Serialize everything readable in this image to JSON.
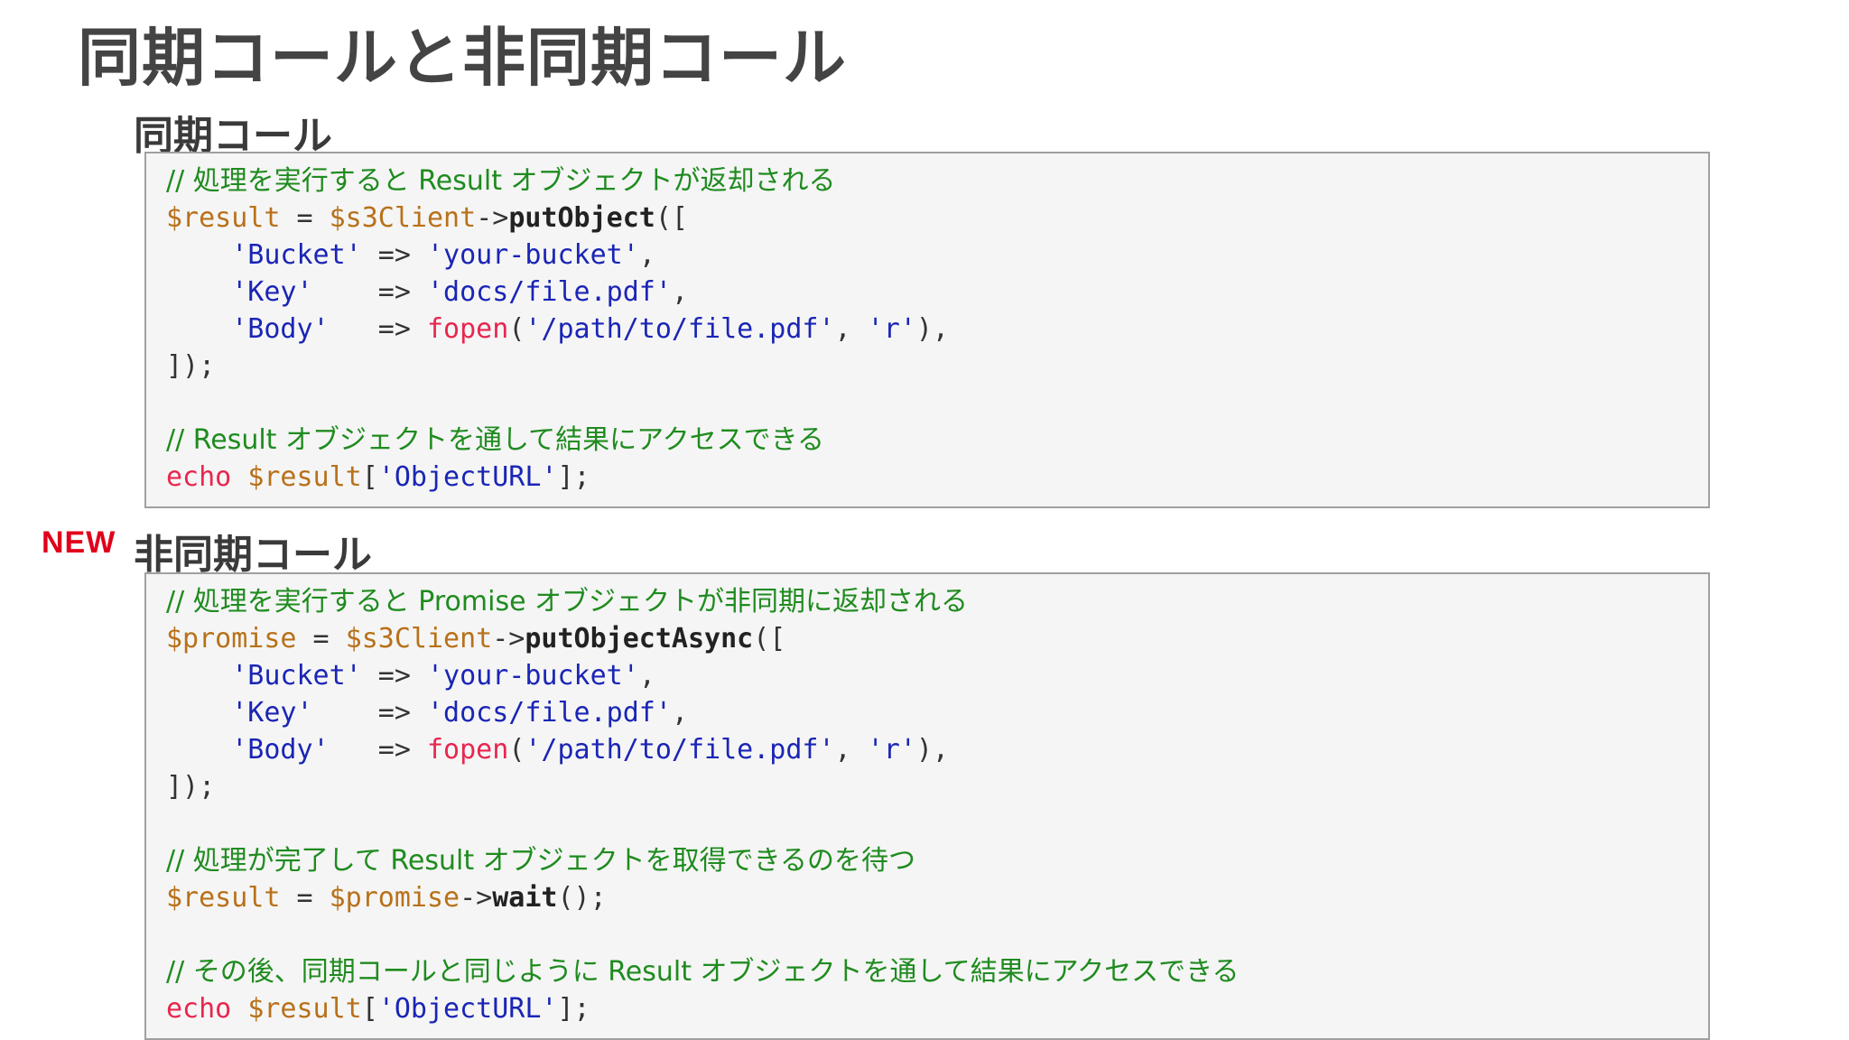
{
  "title": "同期コールと非同期コール",
  "sync": {
    "heading": "同期コール",
    "comment1": "// 処理を実行すると Result オブジェクトが返却される",
    "line1": {
      "var_result": "$result",
      "eq": " = ",
      "var_client": "$s3Client",
      "arrow": "->",
      "method": "putObject",
      "open": "(["
    },
    "bucket": {
      "indent": "    ",
      "key": "'Bucket'",
      "arrow": " => ",
      "value": "'your-bucket'",
      "tail": ","
    },
    "key": {
      "indent": "    ",
      "key": "'Key'",
      "arrow": "    => ",
      "value": "'docs/file.pdf'",
      "tail": ","
    },
    "body": {
      "indent": "    ",
      "key": "'Body'",
      "arrow": "   => ",
      "fn": "fopen",
      "open": "(",
      "arg1": "'/path/to/file.pdf'",
      "sep": ", ",
      "arg2": "'r'",
      "tail": "),"
    },
    "close": "]);",
    "comment2": "// Result オブジェクトを通して結果にアクセスできる",
    "echo": {
      "kw": "echo",
      "space": " ",
      "var": "$result",
      "open": "[",
      "key": "'ObjectURL'",
      "close": "];"
    }
  },
  "async": {
    "badge": "NEW",
    "heading": "非同期コール",
    "comment1": "// 処理を実行すると Promise オブジェクトが非同期に返却される",
    "line1": {
      "var_promise": "$promise",
      "eq": " = ",
      "var_client": "$s3Client",
      "arrow": "->",
      "method": "putObjectAsync",
      "open": "(["
    },
    "bucket": {
      "indent": "    ",
      "key": "'Bucket'",
      "arrow": " => ",
      "value": "'your-bucket'",
      "tail": ","
    },
    "key": {
      "indent": "    ",
      "key": "'Key'",
      "arrow": "    => ",
      "value": "'docs/file.pdf'",
      "tail": ","
    },
    "body": {
      "indent": "    ",
      "key": "'Body'",
      "arrow": "   => ",
      "fn": "fopen",
      "open": "(",
      "arg1": "'/path/to/file.pdf'",
      "sep": ", ",
      "arg2": "'r'",
      "tail": "),"
    },
    "close": "]);",
    "comment2": "// 処理が完了して Result オブジェクトを取得できるのを待つ",
    "wait": {
      "var_result": "$result",
      "eq": " = ",
      "var_promise": "$promise",
      "arrow": "->",
      "method": "wait",
      "tail": "();"
    },
    "comment3": "// その後、同期コールと同じように Result オブジェクトを通して結果にアクセスできる",
    "echo": {
      "kw": "echo",
      "space": " ",
      "var": "$result",
      "open": "[",
      "key": "'ObjectURL'",
      "close": "];"
    }
  },
  "colors": {
    "title": "#444444",
    "comment": "#1f8b1f",
    "variable": "#b8711a",
    "string": "#1a25b5",
    "function": "#e8264f",
    "badge": "#e0001b",
    "code_bg": "#f5f5f5",
    "code_border": "#a0a0a0"
  }
}
